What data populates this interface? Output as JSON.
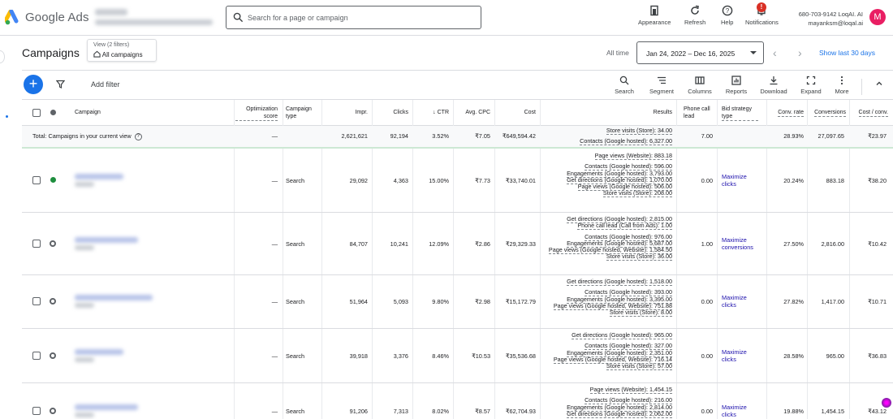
{
  "header": {
    "brand": "Google Ads",
    "search_placeholder": "Search for a page or campaign",
    "actions": [
      {
        "label": "Appearance",
        "icon": "appearance-icon"
      },
      {
        "label": "Refresh",
        "icon": "refresh-icon"
      },
      {
        "label": "Help",
        "icon": "help-icon"
      },
      {
        "label": "Notifications",
        "icon": "bell-icon",
        "badge": "!"
      }
    ],
    "account": {
      "line1": "680-703-9142 LoqAI. AI",
      "line2": "mayanksm@loqal.ai",
      "avatar": "M"
    }
  },
  "page": {
    "title": "Campaigns",
    "view_label": "View (2 filters)",
    "view_value": "All campaigns",
    "all_time": "All time",
    "date_range": "Jan 24, 2022 – Dec 16, 2025",
    "show_last": "Show last 30 days"
  },
  "toolbar": {
    "add_filter": "Add filter",
    "tools": [
      "Search",
      "Segment",
      "Columns",
      "Reports",
      "Download",
      "Expand",
      "More"
    ]
  },
  "columns": {
    "campaign": "Campaign",
    "opt_score": "Optimization score",
    "type": "Campaign type",
    "impr": "Impr.",
    "clicks": "Clicks",
    "ctr": "CTR",
    "avg_cpc": "Avg. CPC",
    "cost": "Cost",
    "results": "Results",
    "phone": "Phone call lead",
    "bid": "Bid strategy type",
    "conv_rate": "Conv. rate",
    "conversions": "Conversions",
    "cost_conv": "Cost / conv."
  },
  "total": {
    "label": "Total: Campaigns in your current view",
    "opt": "—",
    "impr": "2,621,621",
    "clicks": "92,194",
    "ctr": "3.52%",
    "cpc": "₹7.05",
    "cost": "₹649,594.42",
    "results": [
      "Store visits (Store): 34.00",
      "Contacts (Google hosted): 6,327.00"
    ],
    "phone": "7.00",
    "conv_rate": "28.93%",
    "conversions": "27,097.65",
    "cost_conv": "₹23.97"
  },
  "rows": [
    {
      "status": "enabled",
      "opt": "—",
      "type": "Search",
      "impr": "29,092",
      "clicks": "4,363",
      "ctr": "15.00%",
      "cpc": "₹7.73",
      "cost": "₹33,740.01",
      "results_top": "Page views (Website): 883.18",
      "results": [
        "Contacts (Google hosted): 596.00",
        "Engagements (Google hosted): 3,793.00",
        "Get directions (Google hosted): 1,070.00",
        "Page views (Google hosted): 506.00",
        "Store visits (Store): 208.00"
      ],
      "phone": "0.00",
      "bid": [
        "Maximize",
        "clicks"
      ],
      "conv_rate": "20.24%",
      "conversions": "883.18",
      "cost_conv": "₹38.20"
    },
    {
      "status": "paused",
      "opt": "—",
      "type": "Search",
      "impr": "84,707",
      "clicks": "10,241",
      "ctr": "12.09%",
      "cpc": "₹2.86",
      "cost": "₹29,329.33",
      "results_top": "Get directions (Google hosted): 2,815.00",
      "results_top2": "Phone call lead (Call from Ads): 1.00",
      "results": [
        "Contacts (Google hosted): 976.00",
        "Engagements (Google hosted): 5,687.00",
        "Page views (Google hosted, Website): 1,584.50",
        "Store visits (Store): 36.00"
      ],
      "phone": "1.00",
      "bid": [
        "Maximize",
        "conversions"
      ],
      "conv_rate": "27.50%",
      "conversions": "2,816.00",
      "cost_conv": "₹10.42"
    },
    {
      "status": "paused",
      "opt": "—",
      "type": "Search",
      "impr": "51,964",
      "clicks": "5,093",
      "ctr": "9.80%",
      "cpc": "₹2.98",
      "cost": "₹15,172.79",
      "results_top": "Get directions (Google hosted): 1,518.00",
      "results": [
        "Contacts (Google hosted): 393.00",
        "Engagements (Google hosted): 3,395.00",
        "Page views (Google hosted, Website): 751.88",
        "Store visits (Store): 8.00"
      ],
      "phone": "0.00",
      "bid": [
        "Maximize",
        "clicks"
      ],
      "conv_rate": "27.82%",
      "conversions": "1,417.00",
      "cost_conv": "₹10.71"
    },
    {
      "status": "paused",
      "opt": "—",
      "type": "Search",
      "impr": "39,918",
      "clicks": "3,376",
      "ctr": "8.46%",
      "cpc": "₹10.53",
      "cost": "₹35,536.68",
      "results_top": "Get directions (Google hosted): 965.00",
      "results": [
        "Contacts (Google hosted): 327.00",
        "Engagements (Google hosted): 2,351.00",
        "Page views (Google hosted, Website): 716.14",
        "Store visits (Store): 57.00"
      ],
      "phone": "0.00",
      "bid": [
        "Maximize",
        "clicks"
      ],
      "conv_rate": "28.58%",
      "conversions": "965.00",
      "cost_conv": "₹36.83"
    },
    {
      "status": "paused",
      "opt": "—",
      "type": "Search",
      "impr": "91,206",
      "clicks": "7,313",
      "ctr": "8.02%",
      "cpc": "₹8.57",
      "cost": "₹62,704.93",
      "results_top": "Page views (Website): 1,454.15",
      "results": [
        "Contacts (Google hosted): 216.00",
        "Engagements (Google hosted): 2,814.00",
        "Get directions (Google hosted): 2,062.00"
      ],
      "phone": "0.00",
      "bid": [
        "Maximize",
        "clicks"
      ],
      "conv_rate": "19.88%",
      "conversions": "1,454.15",
      "cost_conv": "₹43.12"
    }
  ]
}
